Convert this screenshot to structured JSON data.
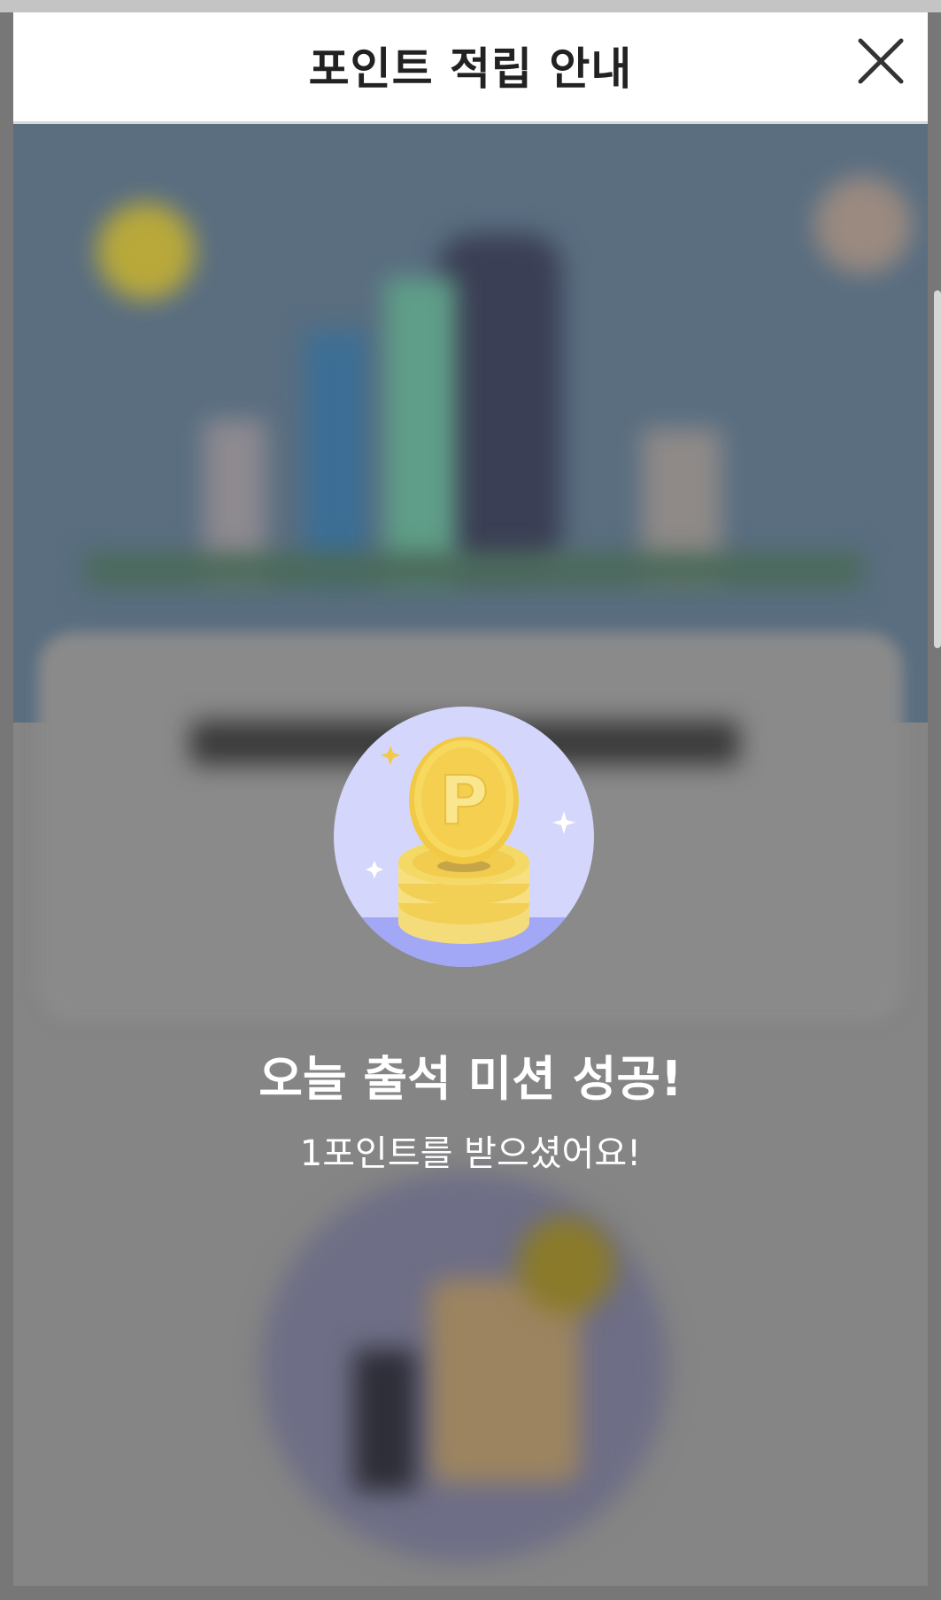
{
  "header": {
    "title": "포인트 적립 안내",
    "close_icon": "close-icon"
  },
  "success": {
    "title": "오늘 출석 미션 성공!",
    "subtitle": "1포인트를 받으셨어요!"
  },
  "icons": {
    "coin": "point-coin-icon",
    "coin_letter": "P"
  },
  "colors": {
    "header_bg": "#ffffff",
    "overlay": "#858585",
    "circle_bg": "#d4d7fb",
    "circle_floor": "#a2a8f5",
    "coin_gold": "#f5d966"
  }
}
